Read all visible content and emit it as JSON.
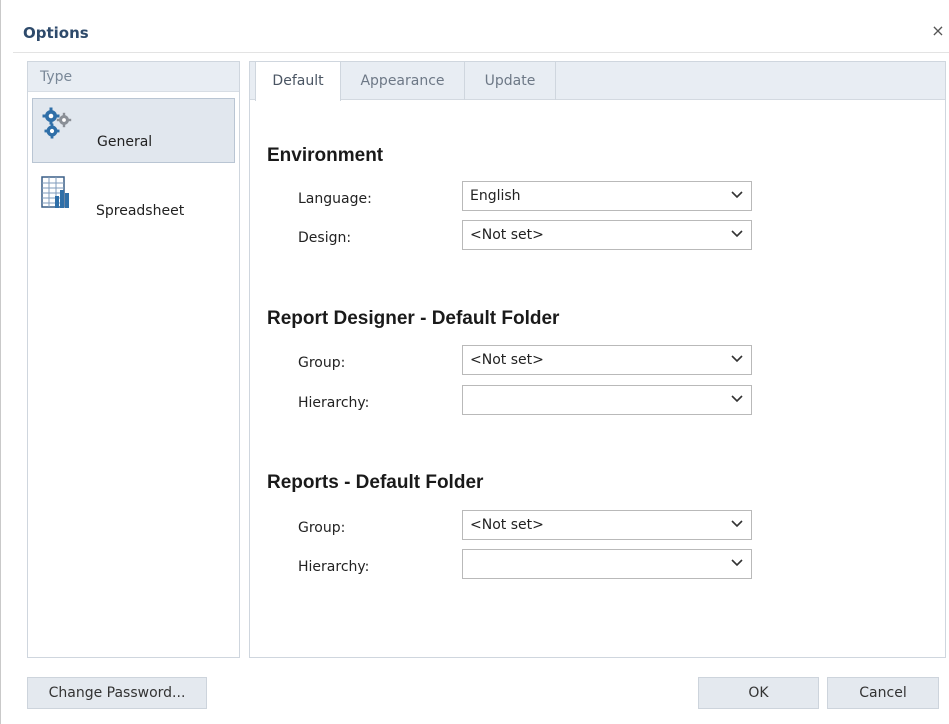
{
  "dialog": {
    "title": "Options",
    "close_icon": "×"
  },
  "type_panel": {
    "header": "Type",
    "items": [
      {
        "label": "General",
        "icon": "gears-icon",
        "selected": true
      },
      {
        "label": "Spreadsheet",
        "icon": "spreadsheet-chart-icon",
        "selected": false
      }
    ]
  },
  "tabs": [
    {
      "label": "Default",
      "active": true
    },
    {
      "label": "Appearance",
      "active": false
    },
    {
      "label": "Update",
      "active": false
    }
  ],
  "sections": [
    {
      "heading": "Environment",
      "fields": [
        {
          "label": "Language:",
          "value": "English"
        },
        {
          "label": "Design:",
          "value": "<Not set>"
        }
      ]
    },
    {
      "heading": "Report Designer - Default Folder",
      "fields": [
        {
          "label": "Group:",
          "value": "<Not set>"
        },
        {
          "label": "Hierarchy:",
          "value": ""
        }
      ]
    },
    {
      "heading": "Reports - Default Folder",
      "fields": [
        {
          "label": "Group:",
          "value": "<Not set>"
        },
        {
          "label": "Hierarchy:",
          "value": ""
        }
      ]
    }
  ],
  "buttons": {
    "change_password": "Change Password...",
    "ok": "OK",
    "cancel": "Cancel"
  },
  "colors": {
    "title": "#2e4a6b",
    "panel_header_bg": "#e8edf3",
    "selected_item_bg": "#e1e7ee",
    "button_bg": "#e4e9ef",
    "gear_blue": "#2f6fa8",
    "gear_gray": "#8a8f96"
  }
}
